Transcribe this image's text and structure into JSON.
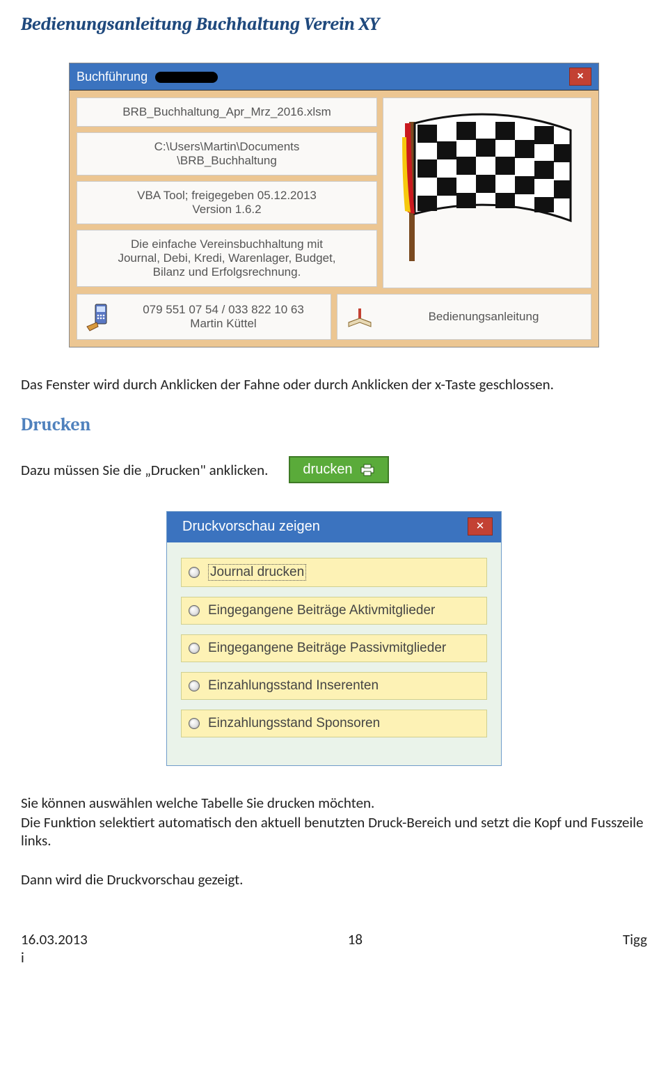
{
  "doc": {
    "title": "Bedienungsanleitung  Buchhaltung Verein XY"
  },
  "about": {
    "titlebar": "Buchführung",
    "close": "×",
    "filename": "BRB_Buchhaltung_Apr_Mrz_2016.xlsm",
    "path1": "C:\\Users\\Martin\\Documents",
    "path2": "\\BRB_Buchhaltung",
    "version1": "VBA Tool; freigegeben 05.12.2013",
    "version2": "Version 1.6.2",
    "desc1": "Die einfache Vereinsbuchhaltung mit",
    "desc2": "Journal, Debi, Kredi, Warenlager, Budget,",
    "desc3": "Bilanz und Erfolgsrechnung.",
    "contact1": "079 551 07 54 / 033 822 10 63",
    "contact2": "Martin Küttel",
    "manual": "Bedienungsanleitung"
  },
  "para1": "Das Fenster wird durch Anklicken der Fahne oder durch Anklicken der x-Taste geschlossen.",
  "h_drucken": "Drucken",
  "para2": "Dazu müssen Sie die „Drucken\" anklicken.",
  "drucken_btn": "drucken",
  "preview": {
    "title": "Druckvorschau zeigen",
    "close": "✕",
    "options": [
      "Journal drucken",
      "Eingegangene Beiträge Aktivmitglieder",
      "Eingegangene Beiträge  Passivmitglieder",
      "Einzahlungsstand Inserenten",
      "Einzahlungsstand Sponsoren"
    ]
  },
  "para3": "Sie können auswählen welche Tabelle Sie drucken möchten.",
  "para4": "Die Funktion selektiert automatisch den aktuell benutzten Druck-Bereich und setzt die Kopf und Fusszeile links.",
  "para5": "Dann wird die Druckvorschau gezeigt.",
  "footer": {
    "date": "16.03.2013",
    "page": "18",
    "author": "Tigg",
    "i": "i"
  }
}
